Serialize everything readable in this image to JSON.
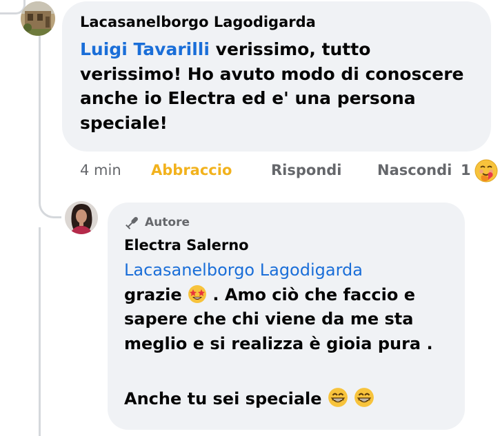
{
  "first_comment": {
    "author": "Lacasanelborgo Lagodigarda",
    "mention": "Luigi Tavarilli",
    "text_lines": [
      " verissimo, tutto",
      "verissimo! Ho avuto modo di conoscere",
      "anche io Electra ed e' una persona",
      "speciale!"
    ],
    "actions": {
      "time": "4 min",
      "reaction": "Abbraccio",
      "reply": "Rispondi",
      "hide": "Nascondi",
      "reaction_count": "1"
    }
  },
  "reply_comment": {
    "badge": "Autore",
    "author": "Electra Salerno",
    "mention": "Lacasanelborgo Lagodigarda",
    "line1_before_emoji": "grazie ",
    "line1_after_emoji": " . Amo ciò che faccio e",
    "line2": "sapere che chi viene da me sta",
    "line3": "meglio e si realizza è gioia pura .",
    "line5": "Anche tu sei speciale "
  },
  "icons": {
    "hug_emoji": "hug-reaction-icon",
    "star_struck_emoji": "star-struck-emoji-icon",
    "grin_emoji": "grinning-emoji-icon",
    "author_badge": "microphone-icon"
  },
  "colors": {
    "mention": "#1a6ed8",
    "reaction": "#f2b21d",
    "bubble": "#f0f2f5",
    "muted": "#65676b"
  }
}
